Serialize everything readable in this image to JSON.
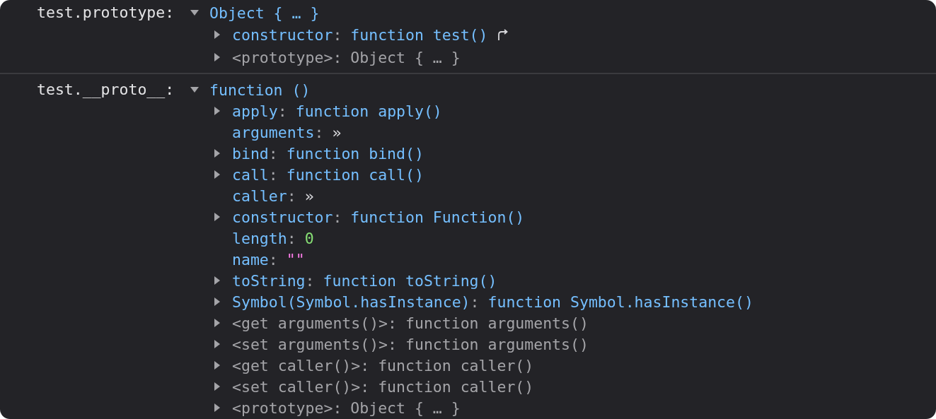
{
  "sections": [
    {
      "label": "test.prototype:",
      "root": {
        "expanded": true,
        "value": "Object { … }"
      },
      "props": [
        {
          "kind": "function",
          "key": "constructor",
          "sep": ":",
          "expandable": true,
          "value": "function test()",
          "jump_link": true
        },
        {
          "kind": "internal",
          "key": "<prototype>",
          "sep": ":",
          "expandable": true,
          "value": "Object { … }"
        }
      ]
    },
    {
      "label": "test.__proto__:",
      "root": {
        "expanded": true,
        "value": "function ()"
      },
      "props": [
        {
          "kind": "function",
          "key": "apply",
          "sep": ":",
          "expandable": true,
          "value": "function apply()"
        },
        {
          "kind": "getter",
          "key": "arguments",
          "sep": ":",
          "expandable": false,
          "value": "»"
        },
        {
          "kind": "function",
          "key": "bind",
          "sep": ":",
          "expandable": true,
          "value": "function bind()"
        },
        {
          "kind": "function",
          "key": "call",
          "sep": ":",
          "expandable": true,
          "value": "function call()"
        },
        {
          "kind": "getter",
          "key": "caller",
          "sep": ":",
          "expandable": false,
          "value": "»"
        },
        {
          "kind": "function",
          "key": "constructor",
          "sep": ":",
          "expandable": true,
          "value": "function Function()"
        },
        {
          "kind": "number",
          "key": "length",
          "sep": ":",
          "expandable": false,
          "value": "0"
        },
        {
          "kind": "string",
          "key": "name",
          "sep": ":",
          "expandable": false,
          "value": "\"\""
        },
        {
          "kind": "function",
          "key": "toString",
          "sep": ":",
          "expandable": true,
          "value": "function toString()"
        },
        {
          "kind": "function",
          "key": "Symbol(Symbol.hasInstance)",
          "sep": ":",
          "expandable": true,
          "value": "function Symbol.hasInstance()"
        },
        {
          "kind": "internal",
          "key": "<get arguments()>",
          "sep": ":",
          "expandable": true,
          "value": "function arguments()"
        },
        {
          "kind": "internal",
          "key": "<set arguments()>",
          "sep": ":",
          "expandable": true,
          "value": "function arguments()"
        },
        {
          "kind": "internal",
          "key": "<get caller()>",
          "sep": ":",
          "expandable": true,
          "value": "function caller()"
        },
        {
          "kind": "internal",
          "key": "<set caller()>",
          "sep": ":",
          "expandable": true,
          "value": "function caller()"
        },
        {
          "kind": "internal",
          "key": "<prototype>",
          "sep": ":",
          "expandable": true,
          "value": "Object { … }"
        }
      ]
    }
  ]
}
